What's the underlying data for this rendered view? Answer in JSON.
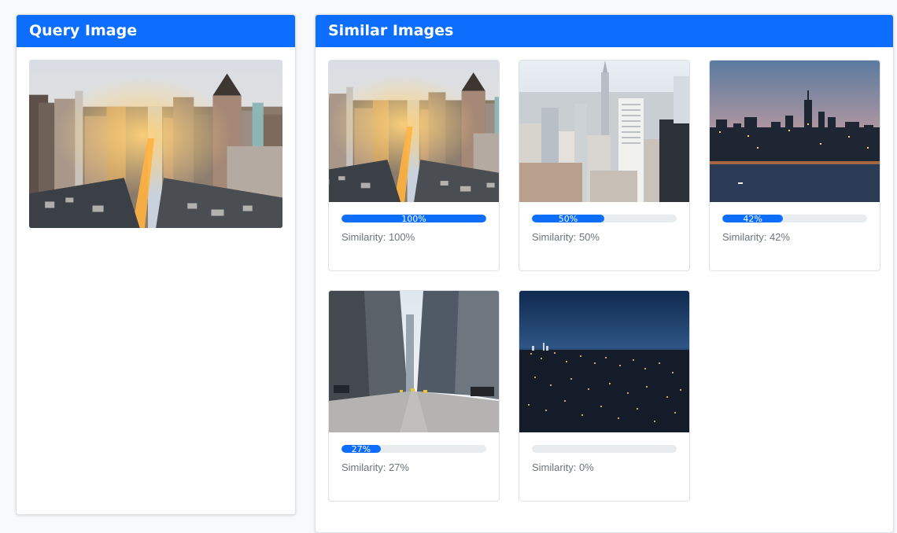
{
  "query_panel": {
    "title": "Query Image",
    "image": "city-street-sunset-skyline-photo"
  },
  "similar_panel": {
    "title": "Similar Images",
    "results": [
      {
        "image": "city-street-sunset-skyline-photo",
        "percent_label": "100%",
        "similarity_text": "Similarity: 100%",
        "score": 1.0
      },
      {
        "image": "manhattan-aerial-skyline-photo",
        "percent_label": "50%",
        "similarity_text": "Similarity: 50%",
        "score": 0.5
      },
      {
        "image": "skyline-at-dusk-over-water-photo",
        "percent_label": "42%",
        "similarity_text": "Similarity: 42%",
        "score": 0.42
      },
      {
        "image": "street-between-skyscrapers-photo",
        "percent_label": "27%",
        "similarity_text": "Similarity: 27%",
        "score": 0.27
      },
      {
        "image": "city-lights-at-night-photo",
        "percent_label": "",
        "similarity_text": "Similarity: 0%",
        "score": 0.0
      }
    ]
  },
  "colors": {
    "accent": "#0d6efd",
    "track": "#e9ecef",
    "muted_text": "#6c757d"
  }
}
